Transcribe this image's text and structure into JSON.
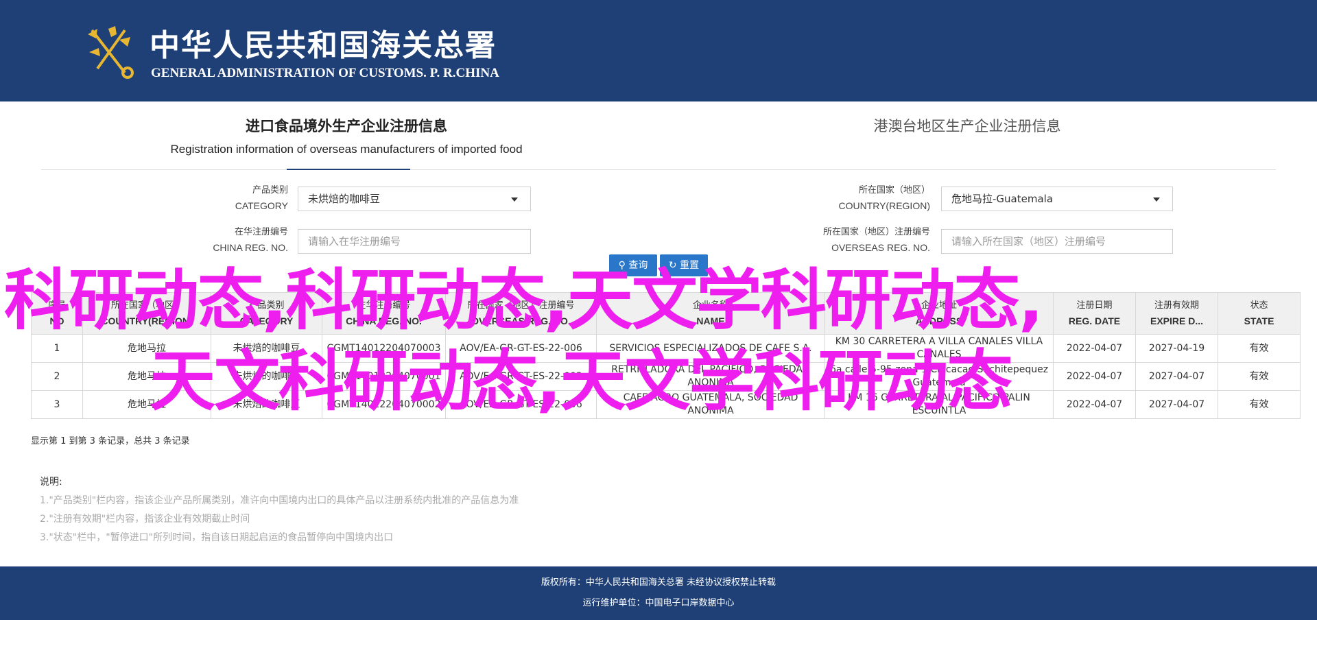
{
  "header": {
    "title_cn": "中华人民共和国海关总署",
    "title_en": "GENERAL ADMINISTRATION OF CUSTOMS. P. R.CHINA",
    "emblem_icon": "customs-emblem-icon"
  },
  "tabs": {
    "active_cn": "进口食品境外生产企业注册信息",
    "active_en": "Registration information of overseas manufacturers of imported food",
    "inactive_cn": "港澳台地区生产企业注册信息"
  },
  "form": {
    "category_label_cn": "产品类别",
    "category_label_en": "CATEGORY",
    "category_value": "未烘焙的咖啡豆",
    "country_label_cn": "所在国家（地区）",
    "country_label_en": "COUNTRY(REGION)",
    "country_value": "危地马拉-Guatemala",
    "china_reg_label_cn": "在华注册编号",
    "china_reg_label_en": "CHINA REG. NO.",
    "china_reg_placeholder": "请输入在华注册编号",
    "overseas_reg_label_cn": "所在国家（地区）注册编号",
    "overseas_reg_label_en": "OVERSEAS REG. NO.",
    "overseas_reg_placeholder": "请输入所在国家（地区）注册编号",
    "search_label": "查询",
    "reset_label": "重置"
  },
  "table": {
    "headers": [
      {
        "cn": "序号",
        "en": "NO"
      },
      {
        "cn": "所在国家（地区）",
        "en": "COUNTRY(REGION)"
      },
      {
        "cn": "产品类别",
        "en": "CATEGORY"
      },
      {
        "cn": "在华注册编号",
        "en": "CHINA REG. NO."
      },
      {
        "cn": "所在国家（地区）注册编号",
        "en": "OVERSEAS REG. NO."
      },
      {
        "cn": "企业名称",
        "en": "NAME"
      },
      {
        "cn": "企业地址",
        "en": "ADDRESS"
      },
      {
        "cn": "注册日期",
        "en": "REG. DATE"
      },
      {
        "cn": "注册有效期",
        "en": "EXPIRE D..."
      },
      {
        "cn": "状态",
        "en": "STATE"
      }
    ],
    "rows": [
      [
        "1",
        "危地马拉",
        "未烘焙的咖啡豆",
        "CGMT14012204070003",
        "AOV/EA-GR-GT-ES-22-006",
        "SERVICIOS ESPECIALIZADOS DE CAFE S.A.",
        "KM 30 CARRETERA A VILLA CANALES VILLA CANALES",
        "2022-04-07",
        "2027-04-19",
        "有效"
      ],
      [
        "2",
        "危地马拉",
        "未烘焙的咖啡豆",
        "CGMT14012204070001",
        "AOV/EA-GR-GT-ES-22-003",
        "RETRILLADORA DEL PACIFICO, SOCIEDAD ANONIMA",
        "6a calle 5-95 zona 1 Chicacao Suchitepequez Guatemala",
        "2022-04-07",
        "2027-04-07",
        "有效"
      ],
      [
        "3",
        "危地马拉",
        "未烘焙的咖啡豆",
        "CGMT14012204070002",
        "AOV/EA-GR-GT-ES-22-006",
        "CAFE AGRO GUATEMALA, SOCIEDAD ANONIMA",
        "KM 16 CARRETERA AL PACIFICO PALIN ESCUINTLA",
        "2022-04-07",
        "2027-04-07",
        "有效"
      ]
    ]
  },
  "summary": "显示第 1 到第 3 条记录，总共 3 条记录",
  "notes": {
    "title": "说明:",
    "items": [
      "1.\"产品类别\"栏内容，指该企业产品所属类别，准许向中国境内出口的具体产品以注册系统内批准的产品信息为准",
      "2.\"注册有效期\"栏内容，指该企业有效期截止时间",
      "3.\"状态\"栏中，\"暂停进口\"所列时间，指自该日期起启运的食品暂停向中国境内出口"
    ]
  },
  "footer": {
    "line1": "版权所有：中华人民共和国海关总署 未经协议授权禁止转载",
    "line2": "运行维护单位：中国电子口岸数据中心"
  },
  "overlay": {
    "line1": "科研动态,科研动态,天文学科研动态,",
    "line2": "天文科研动态,天文学科研动态",
    "color": "#ee1fee"
  },
  "colors": {
    "header_bg": "#1e4077",
    "button_bg": "#2a77c9"
  }
}
